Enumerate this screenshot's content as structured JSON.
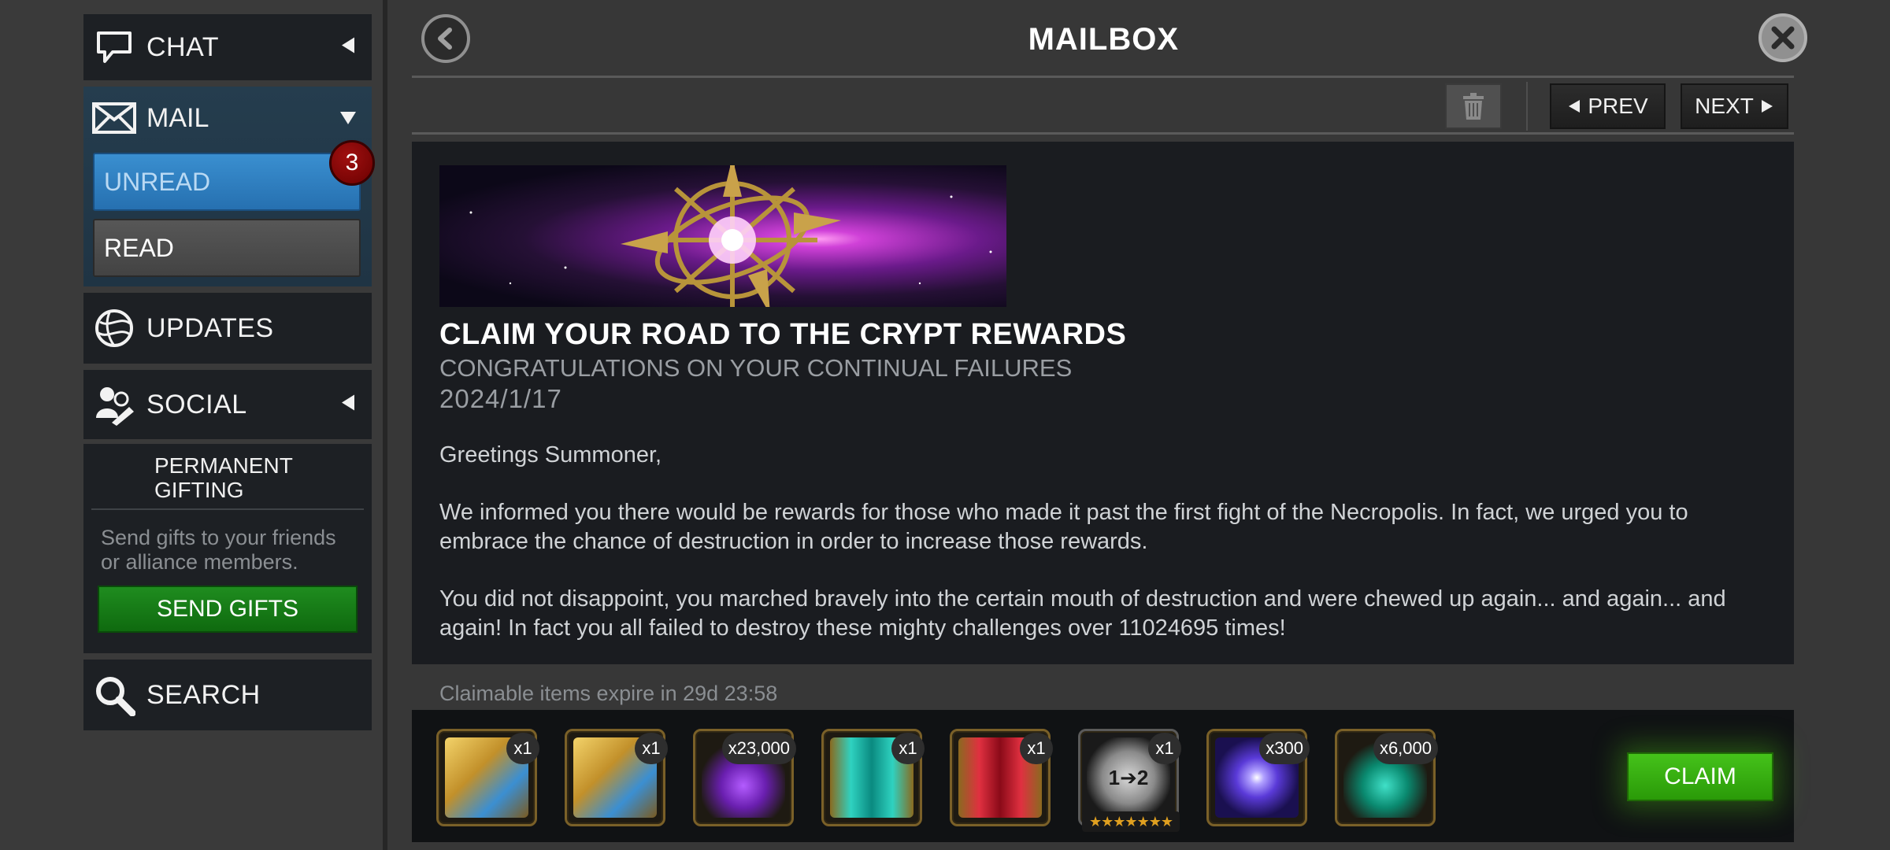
{
  "sidebar": {
    "chat_label": "CHAT",
    "mail_label": "MAIL",
    "unread_label": "UNREAD",
    "unread_count": "3",
    "read_label": "READ",
    "updates_label": "UPDATES",
    "social_label": "SOCIAL",
    "gifting": {
      "title": "PERMANENT GIFTING",
      "description": "Send gifts to your friends or alliance members.",
      "button_label": "SEND GIFTS"
    },
    "search_label": "SEARCH"
  },
  "header": {
    "title": "MAILBOX",
    "prev_label": "PREV",
    "next_label": "NEXT"
  },
  "message": {
    "title": "CLAIM YOUR ROAD TO THE CRYPT REWARDS",
    "subtitle": "CONGRATULATIONS ON YOUR CONTINUAL FAILURES",
    "date": "2024/1/17",
    "paragraphs": [
      "Greetings Summoner,",
      "We informed you there would be rewards for those who made it past the first fight of the Necropolis. In fact, we urged you to embrace the chance of destruction in order to increase those rewards.",
      "You did not disappoint, you marched bravely into the certain mouth of destruction and were chewed up again... and again... and again! In fact you all failed to destroy these mighty challenges over 11024695 times!"
    ]
  },
  "rewards": {
    "expire_text": "Claimable items expire in 29d 23:58",
    "items": [
      {
        "name": "gold-crystal-icon",
        "qty": "x1"
      },
      {
        "name": "gold-crystal-icon",
        "qty": "x1"
      },
      {
        "name": "purple-shard-icon",
        "qty": "x23,000"
      },
      {
        "name": "teal-canister-icon",
        "qty": "x1"
      },
      {
        "name": "red-canister-icon",
        "qty": "x1"
      },
      {
        "name": "rank-up-gem-icon",
        "qty": "x1",
        "stars": "★★★★★★★",
        "label": "1➔2"
      },
      {
        "name": "galaxy-orb-icon",
        "qty": "x300"
      },
      {
        "name": "teal-shard-icon",
        "qty": "x6,000"
      }
    ],
    "claim_label": "CLAIM"
  },
  "colors": {
    "accent_blue": "#2f80c2",
    "send_green": "#138013",
    "claim_green": "#3bb511",
    "badge_red": "#8a0a0a"
  }
}
